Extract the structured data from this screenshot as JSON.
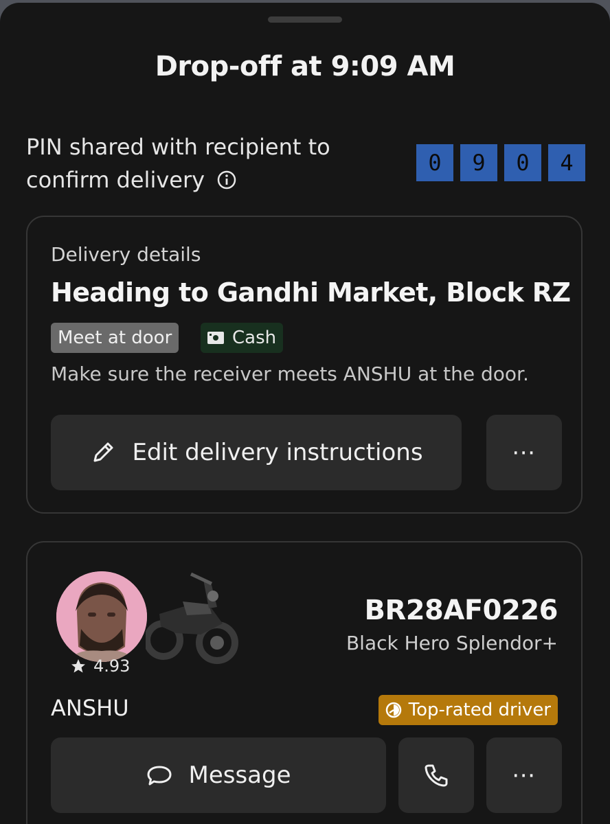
{
  "header": {
    "title": "Drop-off at 9:09 AM"
  },
  "pin": {
    "text_line1": "PIN shared with recipient to",
    "text_line2": "confirm delivery",
    "digits": [
      "0",
      "9",
      "0",
      "4"
    ]
  },
  "delivery": {
    "label": "Delivery details",
    "heading": "Heading to Gandhi Market, Block RZ",
    "chip_door": "Meet at door",
    "chip_cash": "Cash",
    "note": "Make sure the receiver meets ANSHU at the door.",
    "edit_button": "Edit delivery instructions",
    "more_button": "⋯"
  },
  "driver": {
    "rating": "4.93",
    "plate": "BR28AF0226",
    "vehicle": "Black Hero Splendor+",
    "name": "ANSHU",
    "badge": "Top-rated driver",
    "message_button": "Message",
    "more_button": "⋯"
  },
  "colors": {
    "background": "#161616",
    "pin_digit_bg": "#2f5fb0",
    "badge_bg": "#b5790b",
    "cash_chip_bg": "#18301f"
  },
  "icons": [
    "info-icon",
    "pencil-icon",
    "cash-icon",
    "star-icon",
    "badge-icon",
    "message-icon",
    "phone-icon"
  ]
}
